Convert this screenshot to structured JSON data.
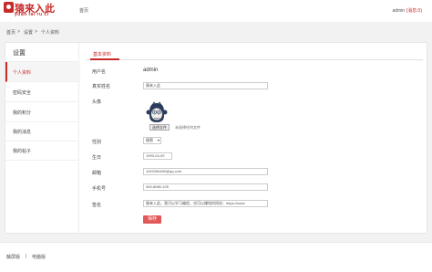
{
  "header": {
    "logo_cn": "猿来入此",
    "logo_en": "yuan lai ru ci",
    "home": "首页",
    "user_name": "admin",
    "user_msg": "(消息:0)"
  },
  "breadcrumb": {
    "home": "首页",
    "sep1": ">",
    "settings": "设置",
    "sep2": ">",
    "current": "个人资料"
  },
  "sidebar": {
    "title": "设置",
    "items": [
      {
        "label": "个人资料"
      },
      {
        "label": "密码安全"
      },
      {
        "label": "我的积分"
      },
      {
        "label": "我的消息"
      },
      {
        "label": "我的帖子"
      }
    ]
  },
  "form": {
    "tab": "基本资料",
    "username_label": "用户名",
    "username_value": "admin",
    "realname_label": "真实姓名",
    "realname_value": "猿来入此",
    "avatar_label": "头像",
    "file_button": "选择文件",
    "file_none": "未选择任何文件",
    "gender_label": "性别",
    "gender_value": "保密",
    "birthday_label": "生日",
    "birthday_value": "1993-04-09",
    "email_label": "邮箱",
    "email_value": "1193284480@qq.com",
    "phone_label": "手机号",
    "phone_value": "400-8080-105",
    "sign_label": "签名",
    "sign_value": "猿来入此，我可以学习编程，也可以赚钱的网站：https://www",
    "save": "保存"
  },
  "footer": {
    "mobile": "触屏版",
    "sep": "|",
    "desktop": "电脑版"
  },
  "colors": {
    "accent": "#c82a2a",
    "save_button": "#e25757"
  }
}
